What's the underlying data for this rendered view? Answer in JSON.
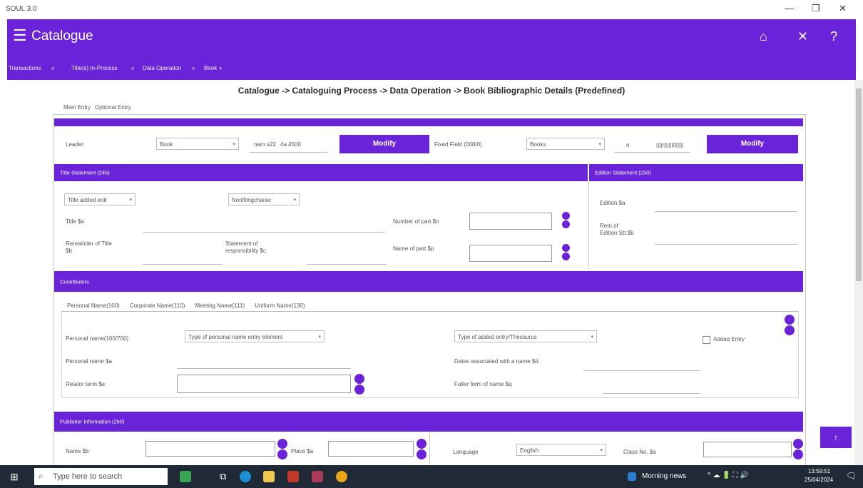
{
  "window": {
    "app_name": "SOUL 3.0",
    "minimize": "—",
    "maximize": "❐",
    "close": "✕"
  },
  "appbar": {
    "title": "Catalogue",
    "menu_icon": "menu-icon",
    "home_icon": "home-icon",
    "close_icon": "close-icon",
    "help_icon": "help-icon"
  },
  "breadcrumb": [
    "Transactions",
    "Title(s) In-Process",
    "Data Operation",
    "Book"
  ],
  "heading": "Catalogue -> Cataloguing Process -> Data Operation -> Book Bibliographic Details (Predefined)",
  "tabs": [
    "Main Entry",
    "Optional Entry"
  ],
  "leader": {
    "label": "Leader",
    "type_value": "Book",
    "code1": "nam a22",
    "code2": "4a 4500",
    "modify": "Modify",
    "fixed_label": "Fixed Field (008/0)",
    "fixed_value": "Books",
    "fixed_code1": "n",
    "fixed_code2": "||||r||||||0|||||",
    "modify2": "Modify"
  },
  "title_statement": {
    "band": "Title Statement (245)",
    "added_entry": "Title added entr",
    "nonfiling": "Nonfilingcharac",
    "title_label": "Title $a",
    "number_part_label": "Number of part $n",
    "remainder_label_1": "Remainder of Title",
    "remainder_label_2": "$b",
    "statement_label_1": "Statement of",
    "statement_label_2": "responsibility $c",
    "name_part_label": "Name of part $p"
  },
  "edition": {
    "band": "Edition Statement (250)",
    "edition_label": "Edition $a",
    "remainder_label_1": "Rem.of",
    "remainder_label_2": "Edition Stt.$b"
  },
  "contributors": {
    "band": "Contributors",
    "tabs": [
      "Personal Name(100)",
      "Corporate Name(110)",
      "Meeting Name(111)",
      "Uniform Name(130)"
    ],
    "personal_name_label": "Personal name(100/700)",
    "type_select": "Type of personal name entry element",
    "added_select": "Type of added entry/Thesaurus",
    "added_entry_checkbox": "Added Entry",
    "personal_a_label": "Personal name $a",
    "dates_label": "Dates associated with a name $d",
    "relator_label": "Relator term $e",
    "fuller_label": "Fuller form of name $q"
  },
  "publisher": {
    "band": "Publisher Information (260)",
    "name_label": "Name $b",
    "place_label": "Place $a",
    "language_label": "Language",
    "language_value": "English",
    "class_label": "Class No. $a"
  },
  "scroll_top": "↑",
  "taskbar": {
    "search_placeholder": "Type here to search",
    "news": "Morning news",
    "time": "13:59:51",
    "date": "25/04/2024"
  }
}
